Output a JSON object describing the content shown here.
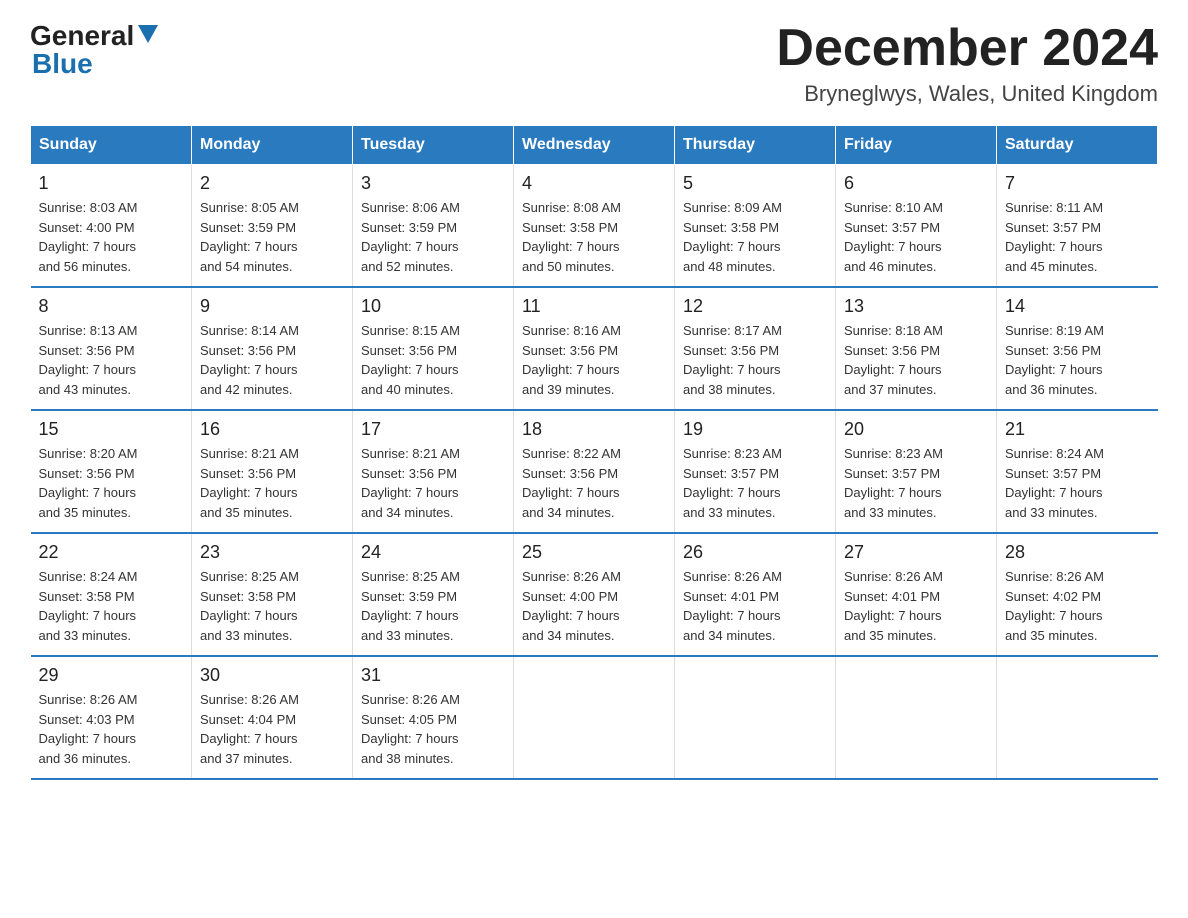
{
  "logo": {
    "line1": "General",
    "arrow": true,
    "line2": "Blue"
  },
  "title": "December 2024",
  "location": "Bryneglwys, Wales, United Kingdom",
  "days_of_week": [
    "Sunday",
    "Monday",
    "Tuesday",
    "Wednesday",
    "Thursday",
    "Friday",
    "Saturday"
  ],
  "weeks": [
    [
      {
        "day": "1",
        "sunrise": "8:03 AM",
        "sunset": "4:00 PM",
        "daylight": "7 hours and 56 minutes."
      },
      {
        "day": "2",
        "sunrise": "8:05 AM",
        "sunset": "3:59 PM",
        "daylight": "7 hours and 54 minutes."
      },
      {
        "day": "3",
        "sunrise": "8:06 AM",
        "sunset": "3:59 PM",
        "daylight": "7 hours and 52 minutes."
      },
      {
        "day": "4",
        "sunrise": "8:08 AM",
        "sunset": "3:58 PM",
        "daylight": "7 hours and 50 minutes."
      },
      {
        "day": "5",
        "sunrise": "8:09 AM",
        "sunset": "3:58 PM",
        "daylight": "7 hours and 48 minutes."
      },
      {
        "day": "6",
        "sunrise": "8:10 AM",
        "sunset": "3:57 PM",
        "daylight": "7 hours and 46 minutes."
      },
      {
        "day": "7",
        "sunrise": "8:11 AM",
        "sunset": "3:57 PM",
        "daylight": "7 hours and 45 minutes."
      }
    ],
    [
      {
        "day": "8",
        "sunrise": "8:13 AM",
        "sunset": "3:56 PM",
        "daylight": "7 hours and 43 minutes."
      },
      {
        "day": "9",
        "sunrise": "8:14 AM",
        "sunset": "3:56 PM",
        "daylight": "7 hours and 42 minutes."
      },
      {
        "day": "10",
        "sunrise": "8:15 AM",
        "sunset": "3:56 PM",
        "daylight": "7 hours and 40 minutes."
      },
      {
        "day": "11",
        "sunrise": "8:16 AM",
        "sunset": "3:56 PM",
        "daylight": "7 hours and 39 minutes."
      },
      {
        "day": "12",
        "sunrise": "8:17 AM",
        "sunset": "3:56 PM",
        "daylight": "7 hours and 38 minutes."
      },
      {
        "day": "13",
        "sunrise": "8:18 AM",
        "sunset": "3:56 PM",
        "daylight": "7 hours and 37 minutes."
      },
      {
        "day": "14",
        "sunrise": "8:19 AM",
        "sunset": "3:56 PM",
        "daylight": "7 hours and 36 minutes."
      }
    ],
    [
      {
        "day": "15",
        "sunrise": "8:20 AM",
        "sunset": "3:56 PM",
        "daylight": "7 hours and 35 minutes."
      },
      {
        "day": "16",
        "sunrise": "8:21 AM",
        "sunset": "3:56 PM",
        "daylight": "7 hours and 35 minutes."
      },
      {
        "day": "17",
        "sunrise": "8:21 AM",
        "sunset": "3:56 PM",
        "daylight": "7 hours and 34 minutes."
      },
      {
        "day": "18",
        "sunrise": "8:22 AM",
        "sunset": "3:56 PM",
        "daylight": "7 hours and 34 minutes."
      },
      {
        "day": "19",
        "sunrise": "8:23 AM",
        "sunset": "3:57 PM",
        "daylight": "7 hours and 33 minutes."
      },
      {
        "day": "20",
        "sunrise": "8:23 AM",
        "sunset": "3:57 PM",
        "daylight": "7 hours and 33 minutes."
      },
      {
        "day": "21",
        "sunrise": "8:24 AM",
        "sunset": "3:57 PM",
        "daylight": "7 hours and 33 minutes."
      }
    ],
    [
      {
        "day": "22",
        "sunrise": "8:24 AM",
        "sunset": "3:58 PM",
        "daylight": "7 hours and 33 minutes."
      },
      {
        "day": "23",
        "sunrise": "8:25 AM",
        "sunset": "3:58 PM",
        "daylight": "7 hours and 33 minutes."
      },
      {
        "day": "24",
        "sunrise": "8:25 AM",
        "sunset": "3:59 PM",
        "daylight": "7 hours and 33 minutes."
      },
      {
        "day": "25",
        "sunrise": "8:26 AM",
        "sunset": "4:00 PM",
        "daylight": "7 hours and 34 minutes."
      },
      {
        "day": "26",
        "sunrise": "8:26 AM",
        "sunset": "4:01 PM",
        "daylight": "7 hours and 34 minutes."
      },
      {
        "day": "27",
        "sunrise": "8:26 AM",
        "sunset": "4:01 PM",
        "daylight": "7 hours and 35 minutes."
      },
      {
        "day": "28",
        "sunrise": "8:26 AM",
        "sunset": "4:02 PM",
        "daylight": "7 hours and 35 minutes."
      }
    ],
    [
      {
        "day": "29",
        "sunrise": "8:26 AM",
        "sunset": "4:03 PM",
        "daylight": "7 hours and 36 minutes."
      },
      {
        "day": "30",
        "sunrise": "8:26 AM",
        "sunset": "4:04 PM",
        "daylight": "7 hours and 37 minutes."
      },
      {
        "day": "31",
        "sunrise": "8:26 AM",
        "sunset": "4:05 PM",
        "daylight": "7 hours and 38 minutes."
      },
      null,
      null,
      null,
      null
    ]
  ]
}
